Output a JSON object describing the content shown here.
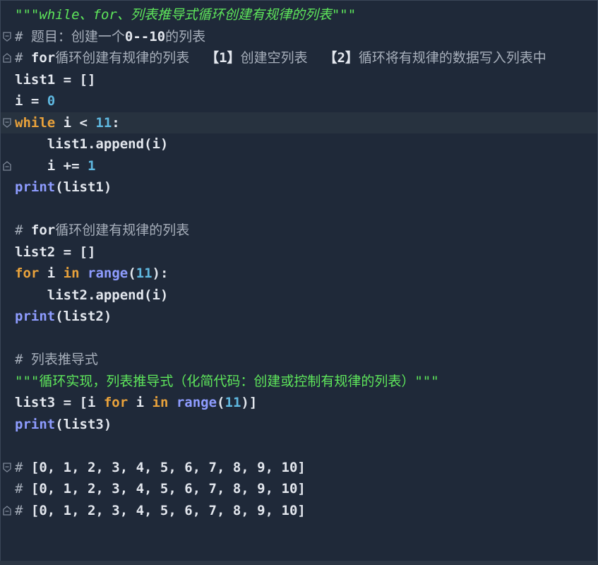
{
  "editor": {
    "language": "python",
    "lines": [
      {
        "text": "\"\"\"while、for、列表推导式循环创建有规律的列表\"\"\""
      },
      {
        "text": "# 题目：创建一个0--10的列表"
      },
      {
        "text": "# for循环创建有规律的列表  【1】创建空列表  【2】循环将有规律的数据写入列表中"
      },
      {
        "text": "list1 = []"
      },
      {
        "text": "i = 0"
      },
      {
        "text": "while i < 11:"
      },
      {
        "text": "    list1.append(i)"
      },
      {
        "text": "    i += 1"
      },
      {
        "text": "print(list1)"
      },
      {
        "text": ""
      },
      {
        "text": "# for循环创建有规律的列表"
      },
      {
        "text": "list2 = []"
      },
      {
        "text": "for i in range(11):"
      },
      {
        "text": "    list2.append(i)"
      },
      {
        "text": "print(list2)"
      },
      {
        "text": ""
      },
      {
        "text": "# 列表推导式"
      },
      {
        "text": "\"\"\"循环实现，列表推导式（化简代码：创建或控制有规律的列表）\"\"\""
      },
      {
        "text": "list3 = [i for i in range(11)]"
      },
      {
        "text": "print(list3)"
      },
      {
        "text": ""
      },
      {
        "text": "# [0, 1, 2, 3, 4, 5, 6, 7, 8, 9, 10]"
      },
      {
        "text": "# [0, 1, 2, 3, 4, 5, 6, 7, 8, 9, 10]"
      },
      {
        "text": "# [0, 1, 2, 3, 4, 5, 6, 7, 8, 9, 10]"
      }
    ],
    "current_line": 6,
    "colors": {
      "background": "#1f2939",
      "current_line": "#27323f",
      "keyword": "#e9a23b",
      "builtin": "#8e9cff",
      "number": "#5fb8e0",
      "comment": "#a7afbb",
      "docstring": "#5ee65b",
      "text": "#e3e7ee"
    }
  }
}
